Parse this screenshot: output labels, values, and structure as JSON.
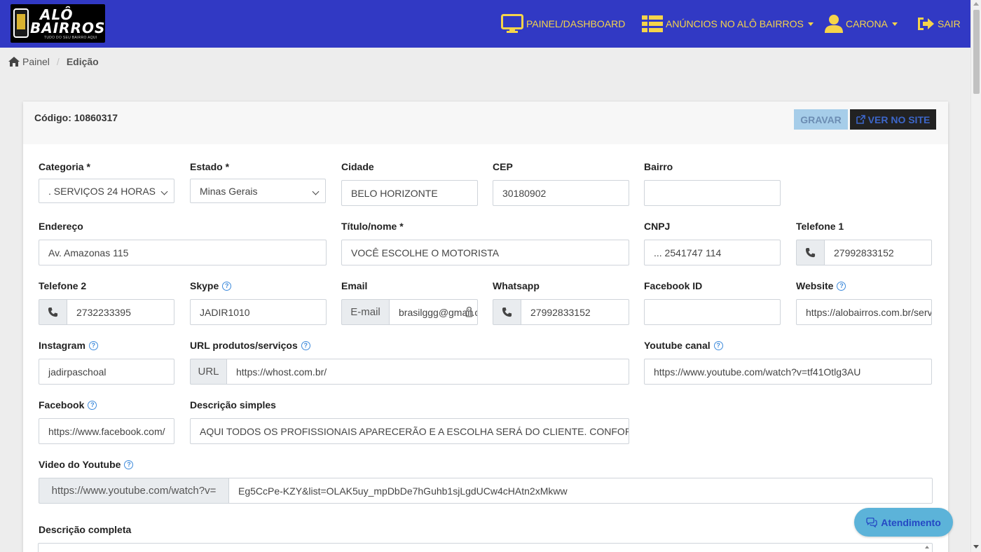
{
  "navbar": {
    "logo": {
      "line1": "ALÔ",
      "line2": "BAIRROS",
      "tagline": "TUDO DO SEU BAIRRO AQUI"
    },
    "items": [
      {
        "label": "PAINEL/DASHBOARD",
        "icon": "monitor-icon"
      },
      {
        "label": "ANÚNCIOS NO ALÔ BAIRROS",
        "icon": "list-icon",
        "dropdown": true
      },
      {
        "label": "CARONA",
        "icon": "user-icon",
        "dropdown": true
      },
      {
        "label": "SAIR",
        "icon": "sign-out-icon"
      }
    ],
    "colors": {
      "background": "#3139c4",
      "text": "#f5d44a"
    }
  },
  "breadcrumb": {
    "home": "Painel",
    "current": "Edição"
  },
  "card": {
    "code": "Código: 10860317",
    "save_label": "GRAVAR",
    "view_label": "VER NO SITE"
  },
  "form": {
    "categoria": {
      "label": "Categoria *",
      "value": ". SERVIÇOS 24 HORAS"
    },
    "estado": {
      "label": "Estado *",
      "value": "Minas Gerais"
    },
    "cidade": {
      "label": "Cidade",
      "value": "BELO HORIZONTE"
    },
    "cep": {
      "label": "CEP",
      "value": "30180902"
    },
    "bairro": {
      "label": "Bairro",
      "value": ""
    },
    "endereco": {
      "label": "Endereço",
      "value": "Av. Amazonas 115"
    },
    "titulo": {
      "label": "Título/nome *",
      "value": "VOCÊ ESCOLHE O MOTORISTA"
    },
    "cnpj": {
      "label": "CNPJ",
      "value": "... 2541747 114"
    },
    "telefone1": {
      "label": "Telefone 1",
      "value": "27992833152"
    },
    "telefone2": {
      "label": "Telefone 2",
      "value": "2732233395"
    },
    "skype": {
      "label": "Skype",
      "value": "JADIR1010"
    },
    "email": {
      "label": "Email",
      "addon": "E-mail",
      "value": "brasilggg@gmail.com"
    },
    "whatsapp": {
      "label": "Whatsapp",
      "value": "27992833152"
    },
    "facebook_id": {
      "label": "Facebook ID",
      "value": ""
    },
    "website": {
      "label": "Website",
      "value": "https://alobairros.com.br/servicos"
    },
    "instagram": {
      "label": "Instagram",
      "value": "jadirpaschoal"
    },
    "url_produtos": {
      "label": "URL produtos/serviços",
      "addon": "URL",
      "value": "https://whost.com.br/"
    },
    "youtube_canal": {
      "label": "Youtube canal",
      "value": "https://www.youtube.com/watch?v=tf41Otlg3AU"
    },
    "facebook": {
      "label": "Facebook",
      "value": "https://www.facebook.com/"
    },
    "descricao_simples": {
      "label": "Descrição simples",
      "value": "AQUI TODOS OS PROFISSIONAIS APARECERÃO E A ESCOLHA SERÁ DO CLIENTE. CONFORTO E SEGURANÇA"
    },
    "video_youtube": {
      "label": "Video do Youtube",
      "addon": "https://www.youtube.com/watch?v=",
      "value": "Eg5CcPe-KZY&list=OLAK5uy_mpDbDe7hGuhb1sjLgdUCw4cHAtn2xMkww"
    },
    "descricao_completa": {
      "label": "Descrição completa"
    }
  },
  "chat": {
    "label": "Atendimento"
  }
}
